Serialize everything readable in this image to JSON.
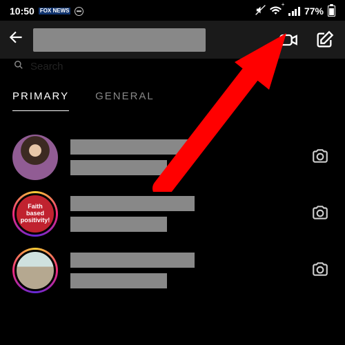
{
  "status": {
    "time": "10:50",
    "fox": "FOX NEWS",
    "battery_pct": "77%"
  },
  "search": {
    "placeholder": "Search"
  },
  "tabs": {
    "primary": "PRIMARY",
    "general": "GENERAL"
  },
  "chats": [
    {
      "avatar_label": ""
    },
    {
      "avatar_label": "Faith based positivity!"
    },
    {
      "avatar_label": ""
    }
  ],
  "colors": {
    "arrow": "#ff0000"
  }
}
